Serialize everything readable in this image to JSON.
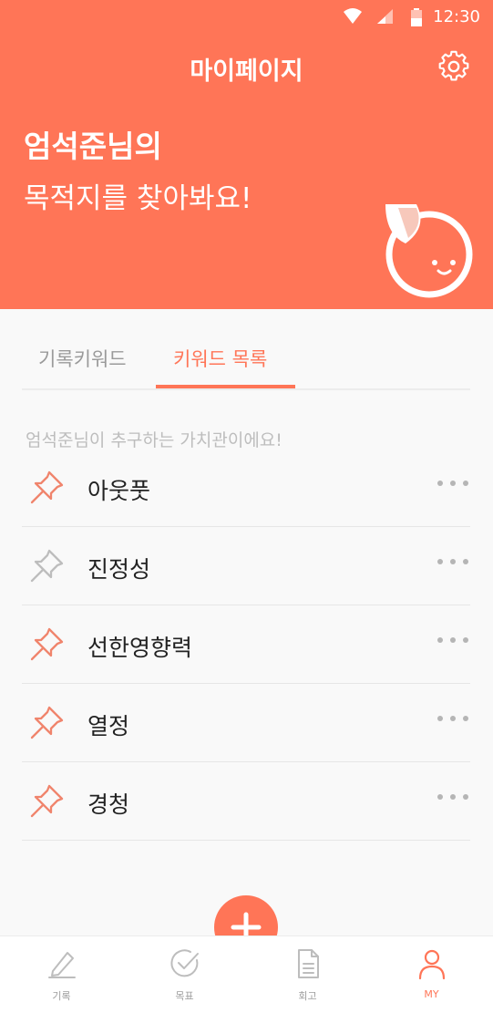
{
  "status_bar": {
    "time": "12:30"
  },
  "header": {
    "title": "마이페이지"
  },
  "hero": {
    "line1": "엄석준님의",
    "line2": "목적지를 찾아봐요!"
  },
  "tabs": [
    {
      "label": "기록키워드",
      "active": false
    },
    {
      "label": "키워드 목록",
      "active": true
    }
  ],
  "section": {
    "subtitle": "엄석준님이 추구하는 가치관이에요!"
  },
  "keywords": [
    {
      "label": "아웃풋",
      "pinned": true
    },
    {
      "label": "진정성",
      "pinned": false
    },
    {
      "label": "선한영향력",
      "pinned": true
    },
    {
      "label": "열정",
      "pinned": true
    },
    {
      "label": "경청",
      "pinned": true
    }
  ],
  "fab": {
    "icon": "plus-icon"
  },
  "bottom_nav": [
    {
      "label": "기록",
      "icon": "pencil-icon",
      "active": false
    },
    {
      "label": "목표",
      "icon": "check-circle-icon",
      "active": false
    },
    {
      "label": "회고",
      "icon": "document-icon",
      "active": false
    },
    {
      "label": "MY",
      "icon": "person-icon",
      "active": true
    }
  ],
  "colors": {
    "accent": "#ff7557",
    "pinned": "#f0846c",
    "unpinned": "#bdbdbd"
  }
}
